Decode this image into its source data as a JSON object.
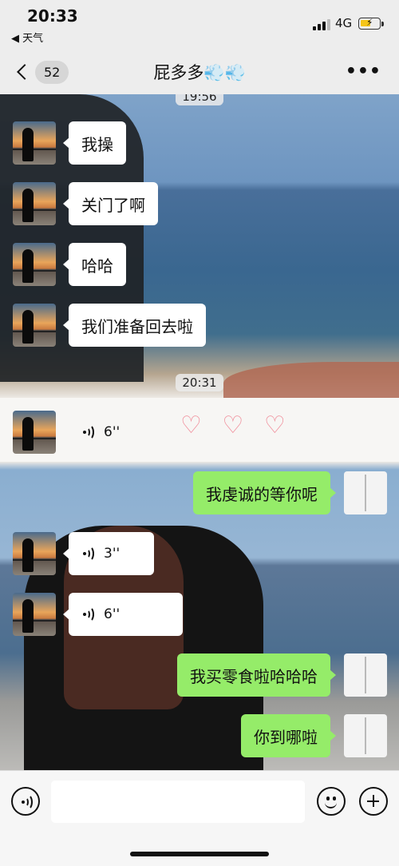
{
  "status_bar": {
    "time": "20:33",
    "back_app": "◀ 天气",
    "network": "4G"
  },
  "nav": {
    "unread_count": "52",
    "title": "屁多多💨💨"
  },
  "chat": {
    "timestamps": [
      "19:56",
      "20:31"
    ],
    "messages": [
      {
        "from": "them",
        "type": "text",
        "text": "我操"
      },
      {
        "from": "them",
        "type": "text",
        "text": "关门了啊"
      },
      {
        "from": "them",
        "type": "text",
        "text": "哈哈"
      },
      {
        "from": "them",
        "type": "text",
        "text": "我们准备回去啦"
      },
      {
        "from": "them",
        "type": "voice",
        "duration": "6''"
      },
      {
        "from": "me",
        "type": "text",
        "text": "我虔诚的等你呢"
      },
      {
        "from": "them",
        "type": "voice",
        "duration": "3''"
      },
      {
        "from": "them",
        "type": "voice",
        "duration": "6''"
      },
      {
        "from": "me",
        "type": "text",
        "text": "我买零食啦哈哈哈"
      },
      {
        "from": "me",
        "type": "text",
        "text": "你到哪啦"
      }
    ],
    "decoration": "♡ ♡ ♡"
  },
  "input_bar": {
    "placeholder": ""
  },
  "colors": {
    "incoming_bubble": "#ffffff",
    "outgoing_bubble": "#95ec69",
    "background": "#ededed"
  }
}
